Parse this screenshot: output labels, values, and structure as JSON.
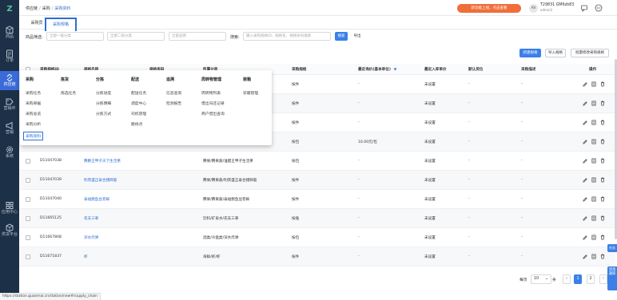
{
  "sidebar": {
    "logo": "Z",
    "items": [
      {
        "label": "商品",
        "icon": "box-icon"
      },
      {
        "label": "订单",
        "icon": "order-icon"
      },
      {
        "label": "供应链",
        "icon": "link-icon"
      },
      {
        "label": "营销中",
        "icon": "tag-icon"
      },
      {
        "label": "营销",
        "icon": "megaphone-icon"
      },
      {
        "label": "系统",
        "icon": "gear-icon"
      },
      {
        "label": "应用中心",
        "icon": "apps-icon"
      },
      {
        "label": "供货平台",
        "icon": "platform-icon"
      }
    ]
  },
  "header": {
    "breadcrumb": [
      "供应链",
      "采购",
      "采购资料"
    ],
    "update_button": "新功能上线，点击查看",
    "avatar": "AV",
    "user_name": "T29831 GM6zb83",
    "user_sub": "admin3"
  },
  "tabs": [
    "采购员",
    "采购规格"
  ],
  "filters": {
    "label": "商品筛选:",
    "cat1_placeholder": "全部一级分类",
    "cat2_placeholder": "全部二级分类",
    "brand_placeholder": "全部品牌",
    "search_label": "搜索:",
    "search_placeholder": "输入采购规格ID、规格名、规格条码搜索",
    "search_button": "搜索",
    "export_button": "导出"
  },
  "actions": {
    "new_button": "新建规格",
    "import_button": "导入规格",
    "batch_button": "批量修改采购规格"
  },
  "table": {
    "headers": [
      "采购规格ID",
      "规格名称",
      "规格条码",
      "所属分类",
      "采购规格",
      "最近询价(基本单位)",
      "最近入库单价",
      "默认货位",
      "采购描述",
      "操作"
    ],
    "rows": [
      {
        "id": "",
        "name": "",
        "code": "",
        "category": "",
        "spec": "按件",
        "price": "-",
        "in_price": "未设置",
        "loc": "-",
        "desc": "-"
      },
      {
        "id": "",
        "name": "",
        "code": "",
        "category": "",
        "spec": "按件",
        "price": "-",
        "in_price": "未设置",
        "loc": "-",
        "desc": "-"
      },
      {
        "id": "",
        "name": "",
        "code": "",
        "category": "",
        "spec": "按件",
        "price": "-",
        "in_price": "未设置",
        "loc": "-",
        "desc": "-"
      },
      {
        "id": "",
        "name": "",
        "code": "",
        "category": "",
        "spec": "按包",
        "price": "10.00元/包",
        "in_price": "未设置",
        "loc": "-",
        "desc": "-"
      },
      {
        "id": "D11047038",
        "name": "腾鹏王甲子天下生活茶",
        "code": "",
        "category": "腾果/腾果蔬/淮腊王甲子生活茶",
        "spec": "按包",
        "price": "-",
        "in_price": "未设置",
        "loc": "-",
        "desc": "-"
      },
      {
        "id": "D11047039",
        "name": "利宾盛正泰合猪蹄筋",
        "code": "",
        "category": "腾果/腾果蔬/利宾盛正泰合猪蹄筋",
        "spec": "按件",
        "price": "-",
        "in_price": "未设置",
        "loc": "-",
        "desc": "-"
      },
      {
        "id": "D11047040",
        "name": "泰福鲍鱼豆卷鲜",
        "code": "",
        "category": "腾果/腾果蔬/泰福鲍鱼豆卷鲜",
        "spec": "按件",
        "price": "-",
        "in_price": "未设置",
        "loc": "-",
        "desc": "-"
      },
      {
        "id": "D11665125",
        "name": "农夫三拳",
        "code": "",
        "category": "饮料/矿泉水/农夫三拳",
        "spec": "按瓶",
        "price": "-",
        "in_price": "未设置",
        "loc": "-",
        "desc": "-"
      },
      {
        "id": "D11667808",
        "name": "深水炸弹",
        "code": "",
        "category": "酒类/冷盘类/深水炸弹",
        "spec": "按包",
        "price": "-",
        "in_price": "未设置",
        "loc": "-",
        "desc": "-"
      },
      {
        "id": "D11671837",
        "name": "虾",
        "code": "",
        "category": "海鲜/虾/虾",
        "spec": "按件",
        "price": "-",
        "in_price": "未设置",
        "loc": "-",
        "desc": "-"
      }
    ]
  },
  "menu": {
    "columns": [
      {
        "title": "采购",
        "items": [
          "采购任务",
          "采购单据",
          "采购总览",
          "采购分析",
          "采购资料"
        ]
      },
      {
        "title": "拣货",
        "items": [
          "拣选任务"
        ]
      },
      {
        "title": "分拣",
        "items": [
          "分拣进度",
          "分拣明细",
          "分拣方式"
        ]
      },
      {
        "title": "配送",
        "items": [
          "配送任务",
          "调度中心",
          "司机管理",
          "路线点"
        ]
      },
      {
        "title": "追溯",
        "items": [
          "信息查询",
          "检测报告"
        ]
      },
      {
        "title": "周转物管理",
        "items": [
          "周转物列表",
          "借出归还记录",
          "商户借出查询"
        ]
      },
      {
        "title": "装箱",
        "items": [
          "装箱管理"
        ]
      }
    ]
  },
  "pagination": {
    "per_page_label": "每页",
    "per_page": "10",
    "unit": "条",
    "prev": "‹",
    "pages": [
      "1",
      "2"
    ],
    "next": "›"
  },
  "status_url": "https://station.guanmai.cn/station/new#/supply_chain",
  "right_float": [
    "任务",
    "消息通知"
  ],
  "colors": {
    "primary": "#3a80e8",
    "sidebar": "#1c3047",
    "orange": "#f06e3a",
    "link": "#2f6fd6"
  }
}
